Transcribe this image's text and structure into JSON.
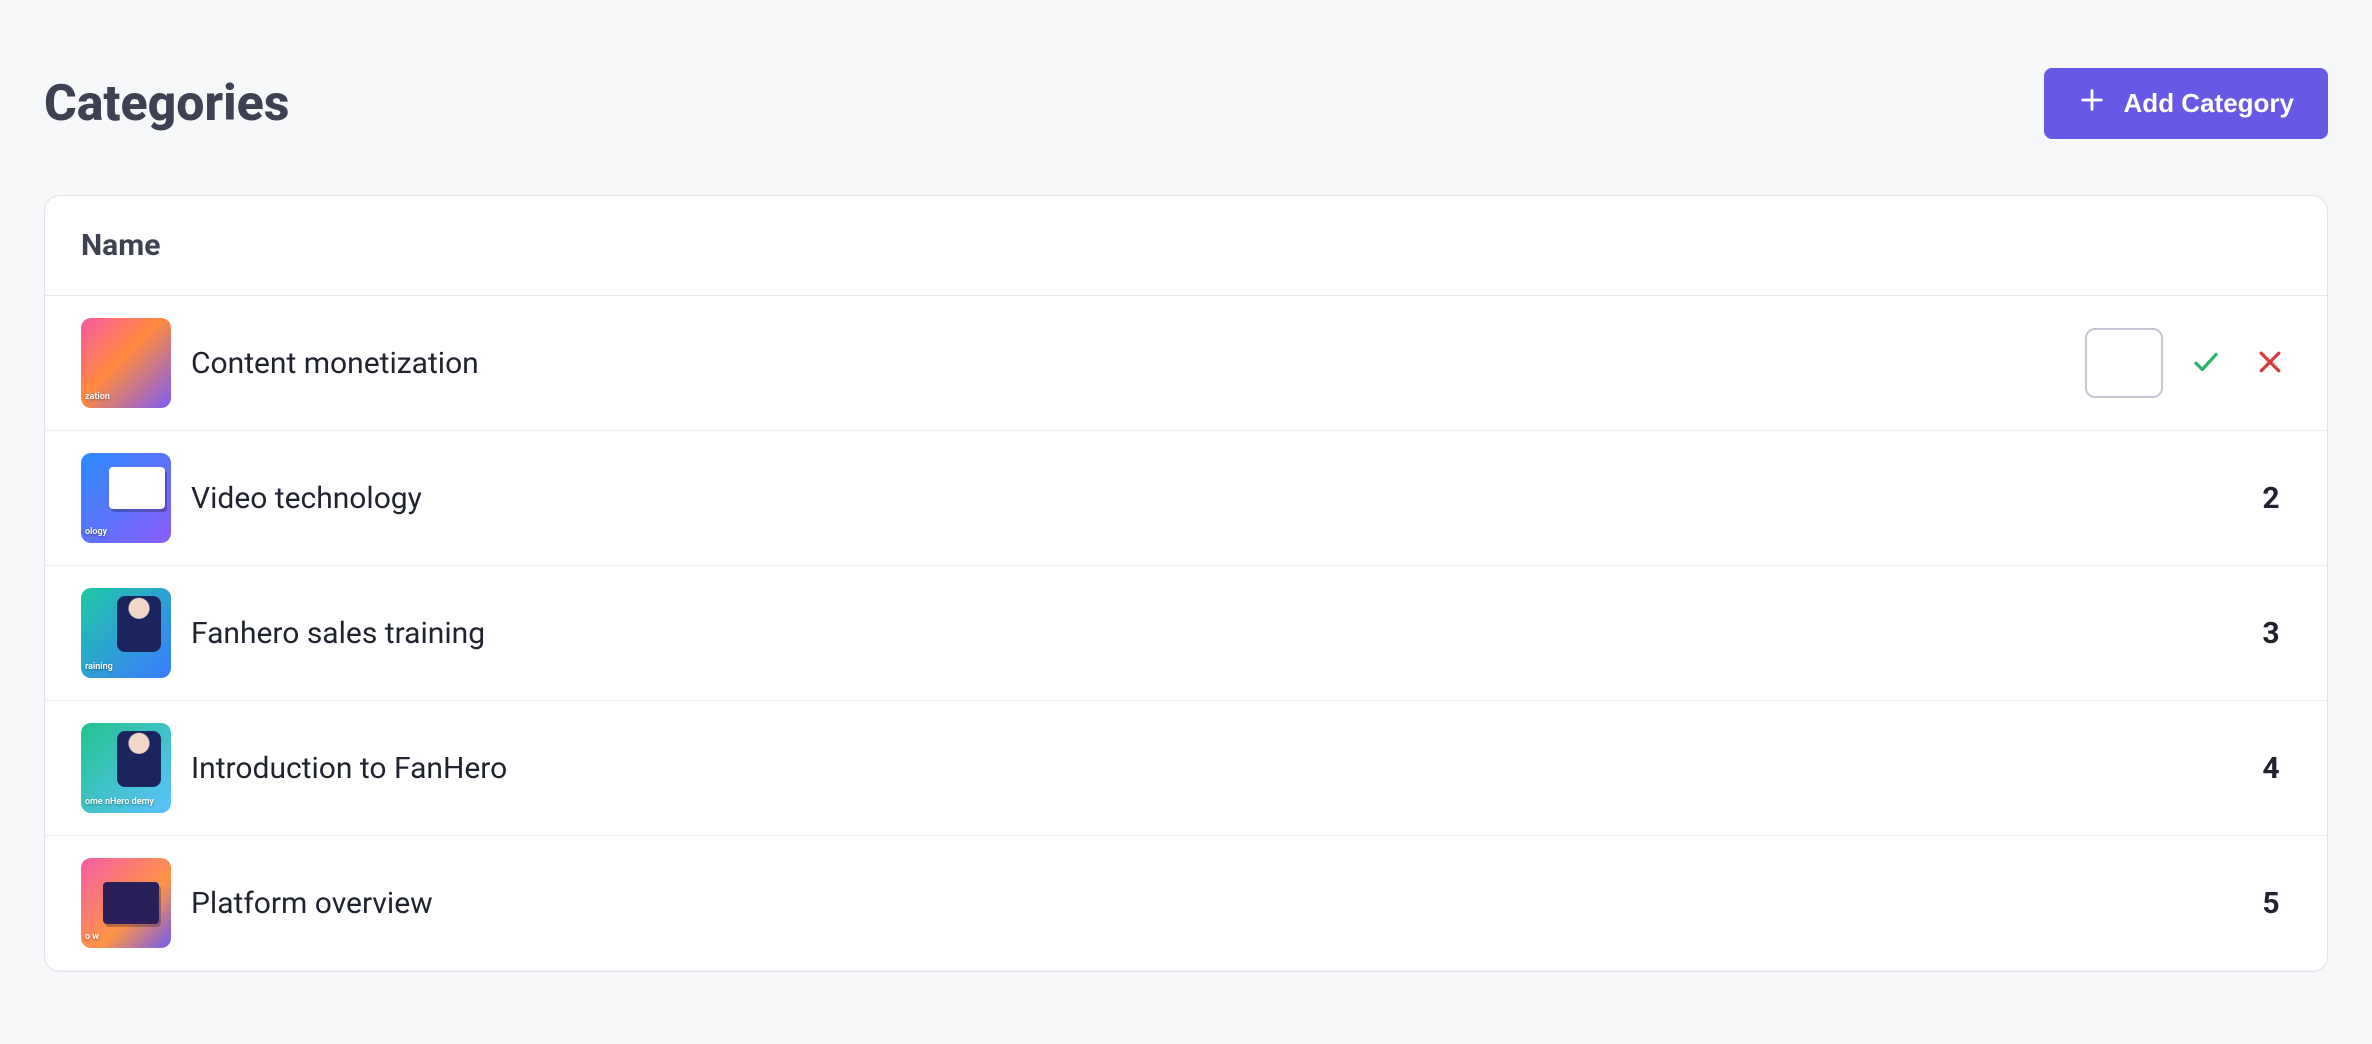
{
  "page_title": "Categories",
  "add_button_label": "Add Category",
  "table": {
    "header_name": "Name"
  },
  "rows": [
    {
      "name": "Content monetization",
      "thumb_gradient": "g1",
      "thumb_caption": "zation",
      "editing": true,
      "value": ""
    },
    {
      "name": "Video technology",
      "thumb_gradient": "g2",
      "thumb_caption": "ology",
      "editing": false,
      "value": "2"
    },
    {
      "name": "Fanhero sales training",
      "thumb_gradient": "g3",
      "thumb_caption": "raining",
      "editing": false,
      "value": "3"
    },
    {
      "name": "Introduction to FanHero",
      "thumb_gradient": "g4",
      "thumb_caption": "ome\nnHero\ndemy",
      "editing": false,
      "value": "4"
    },
    {
      "name": "Platform overview",
      "thumb_gradient": "g5",
      "thumb_caption": "o\nw",
      "editing": false,
      "value": "5"
    }
  ],
  "icons": {
    "plus": "plus-icon",
    "check": "check-icon",
    "close": "close-icon"
  },
  "colors": {
    "accent": "#6758e6",
    "success": "#2fb36b",
    "danger": "#d83a3a"
  }
}
